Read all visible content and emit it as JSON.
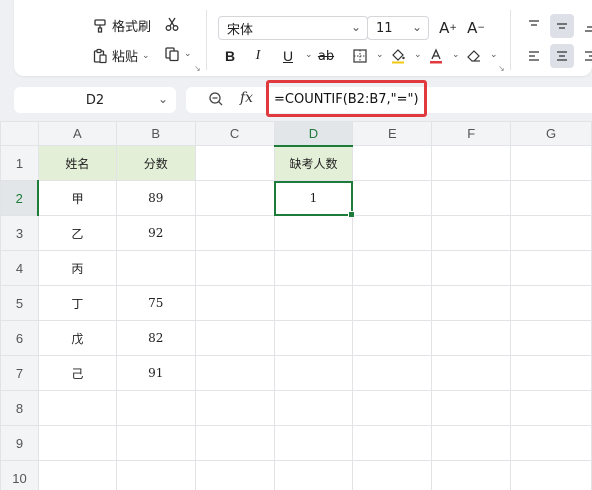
{
  "toolbar": {
    "format_painter": "格式刷",
    "paste": "粘贴",
    "font_name": "宋体",
    "font_size": "11",
    "bold": "B",
    "italic": "I",
    "underline": "U",
    "strike": "ab",
    "increase_font": "A",
    "decrease_font": "A"
  },
  "formula_bar": {
    "cell_ref": "D2",
    "fx": "fx",
    "formula": "=COUNTIF(B2:B7,\"=\")"
  },
  "sheet": {
    "columns": [
      "A",
      "B",
      "C",
      "D",
      "E",
      "F",
      "G"
    ],
    "rows": [
      {
        "n": "1",
        "cells": [
          "姓名",
          "分数",
          "",
          "缺考人数",
          "",
          "",
          ""
        ]
      },
      {
        "n": "2",
        "cells": [
          "甲",
          "89",
          "",
          "1",
          "",
          "",
          ""
        ]
      },
      {
        "n": "3",
        "cells": [
          "乙",
          "92",
          "",
          "",
          "",
          "",
          ""
        ]
      },
      {
        "n": "4",
        "cells": [
          "丙",
          "",
          "",
          "",
          "",
          "",
          ""
        ]
      },
      {
        "n": "5",
        "cells": [
          "丁",
          "75",
          "",
          "",
          "",
          "",
          ""
        ]
      },
      {
        "n": "6",
        "cells": [
          "戊",
          "82",
          "",
          "",
          "",
          "",
          ""
        ]
      },
      {
        "n": "7",
        "cells": [
          "己",
          "91",
          "",
          "",
          "",
          "",
          ""
        ]
      },
      {
        "n": "8",
        "cells": [
          "",
          "",
          "",
          "",
          "",
          "",
          ""
        ]
      },
      {
        "n": "9",
        "cells": [
          "",
          "",
          "",
          "",
          "",
          "",
          ""
        ]
      },
      {
        "n": "10",
        "cells": [
          "",
          "",
          "",
          "",
          "",
          "",
          ""
        ]
      }
    ]
  },
  "colors": {
    "accent": "#1e7c3a",
    "header_fill": "#e3efd7",
    "highlight_box": "#e0393e"
  }
}
